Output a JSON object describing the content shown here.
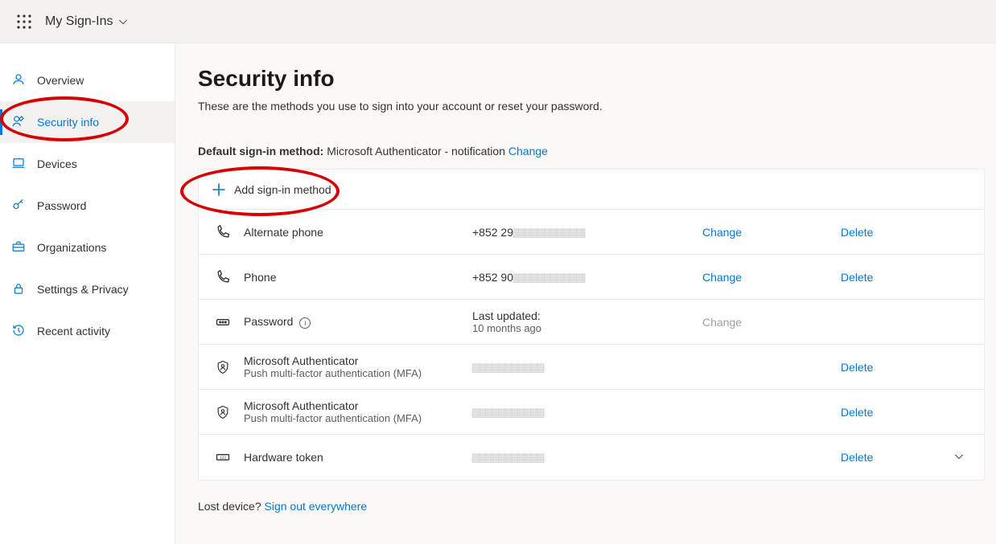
{
  "header": {
    "brand": "My Sign-Ins"
  },
  "sidebar": {
    "items": [
      {
        "icon": "person",
        "label": "Overview"
      },
      {
        "icon": "wrench",
        "label": "Security info",
        "active": true
      },
      {
        "icon": "laptop",
        "label": "Devices"
      },
      {
        "icon": "key",
        "label": "Password"
      },
      {
        "icon": "briefcase",
        "label": "Organizations"
      },
      {
        "icon": "lock",
        "label": "Settings & Privacy"
      },
      {
        "icon": "history",
        "label": "Recent activity"
      }
    ]
  },
  "page": {
    "title": "Security info",
    "subtitle": "These are the methods you use to sign into your account or reset your password.",
    "default_label": "Default sign-in method:",
    "default_value": "Microsoft Authenticator - notification",
    "change": "Change",
    "add_label": "Add sign-in method",
    "lost_label": "Lost device?",
    "signout_label": "Sign out everywhere"
  },
  "methods": [
    {
      "icon": "phone",
      "name": "Alternate phone",
      "value_prefix": "+852 29",
      "value_redacted": true,
      "change": "Change",
      "delete": "Delete"
    },
    {
      "icon": "phone",
      "name": "Phone",
      "value_prefix": "+852 90",
      "value_redacted": true,
      "change": "Change",
      "delete": "Delete"
    },
    {
      "icon": "password",
      "name": "Password",
      "info": true,
      "value_line1": "Last updated:",
      "value_line2": "10 months ago",
      "change": "Change",
      "change_disabled": true
    },
    {
      "icon": "authenticator",
      "name": "Microsoft Authenticator",
      "subname": "Push multi-factor authentication (MFA)",
      "value_redacted": true,
      "delete": "Delete"
    },
    {
      "icon": "authenticator",
      "name": "Microsoft Authenticator",
      "subname": "Push multi-factor authentication (MFA)",
      "value_redacted": true,
      "delete": "Delete"
    },
    {
      "icon": "token",
      "name": "Hardware token",
      "value_redacted": true,
      "delete": "Delete",
      "caret": true
    }
  ]
}
